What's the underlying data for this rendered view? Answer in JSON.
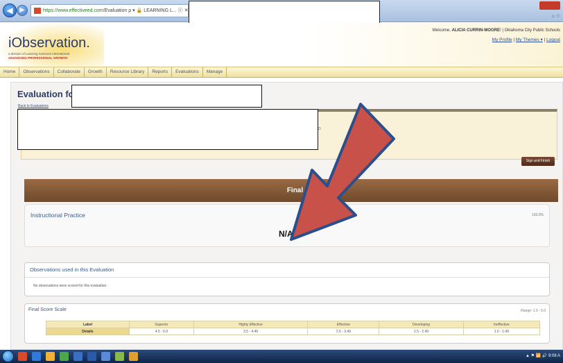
{
  "browser": {
    "nav_back": "◀",
    "nav_forward": "▶",
    "address_url": "https://www.effectiveed.com/",
    "address_tail": "Evaluation ρ ▾ 🔒 LEARNING L... ⓒ ✕",
    "window_subtext": "⌂ ☆"
  },
  "header": {
    "logo_text": "iObservation.",
    "logo_sub1": "a division of Learning Sciences International",
    "logo_sub2": "ADVANCING PROFESSIONAL GROWTH",
    "welcome_prefix": "Welcome,",
    "welcome_name": "ALICIA CURRIN-MOORE",
    "welcome_suffix": "! | Oklahoma City Public Schools",
    "links": [
      "My Profile",
      "My Themes ▾",
      "Logout"
    ]
  },
  "nav": {
    "items": [
      "Home",
      "Observations",
      "Collaborate",
      "Growth",
      "Resource Library",
      "Reports",
      "Evaluations",
      "Manage"
    ]
  },
  "page": {
    "title": "Evaluation fo",
    "back_link": "Back to Evaluations",
    "info_fragment": "D",
    "sign_button": "Sign and Finish"
  },
  "final_score": {
    "banner": "Final Scor",
    "instructional_practice_label": "Instructional Practice",
    "instructional_practice_pct": "100.0%",
    "score_value": "N/A"
  },
  "observations": {
    "title": "Observations used in this Evaluation",
    "message": "No observations were scored for this evaluation."
  },
  "scale": {
    "title": "Final Score Scale",
    "range": "Range: 1.0 - 5.0",
    "header_row_label": "Label",
    "detail_row_label": "Details",
    "labels": [
      "Superior",
      "Highly Effective",
      "Effective",
      "Developing",
      "Ineffective"
    ],
    "details": [
      "4.5 - 5.0",
      "3.5 - 4.49",
      "2.5 - 3.49",
      "1.5 - 2.49",
      "1.0 - 1.49"
    ]
  },
  "taskbar": {
    "tray_text": "▲ ⚑ 📶 🔊  9:08 A"
  },
  "colors": {
    "nav_bg": "#efe0a0",
    "banner": "#7d5535",
    "arrow_fill": "#c8514a",
    "arrow_stroke": "#2b4f8c"
  }
}
